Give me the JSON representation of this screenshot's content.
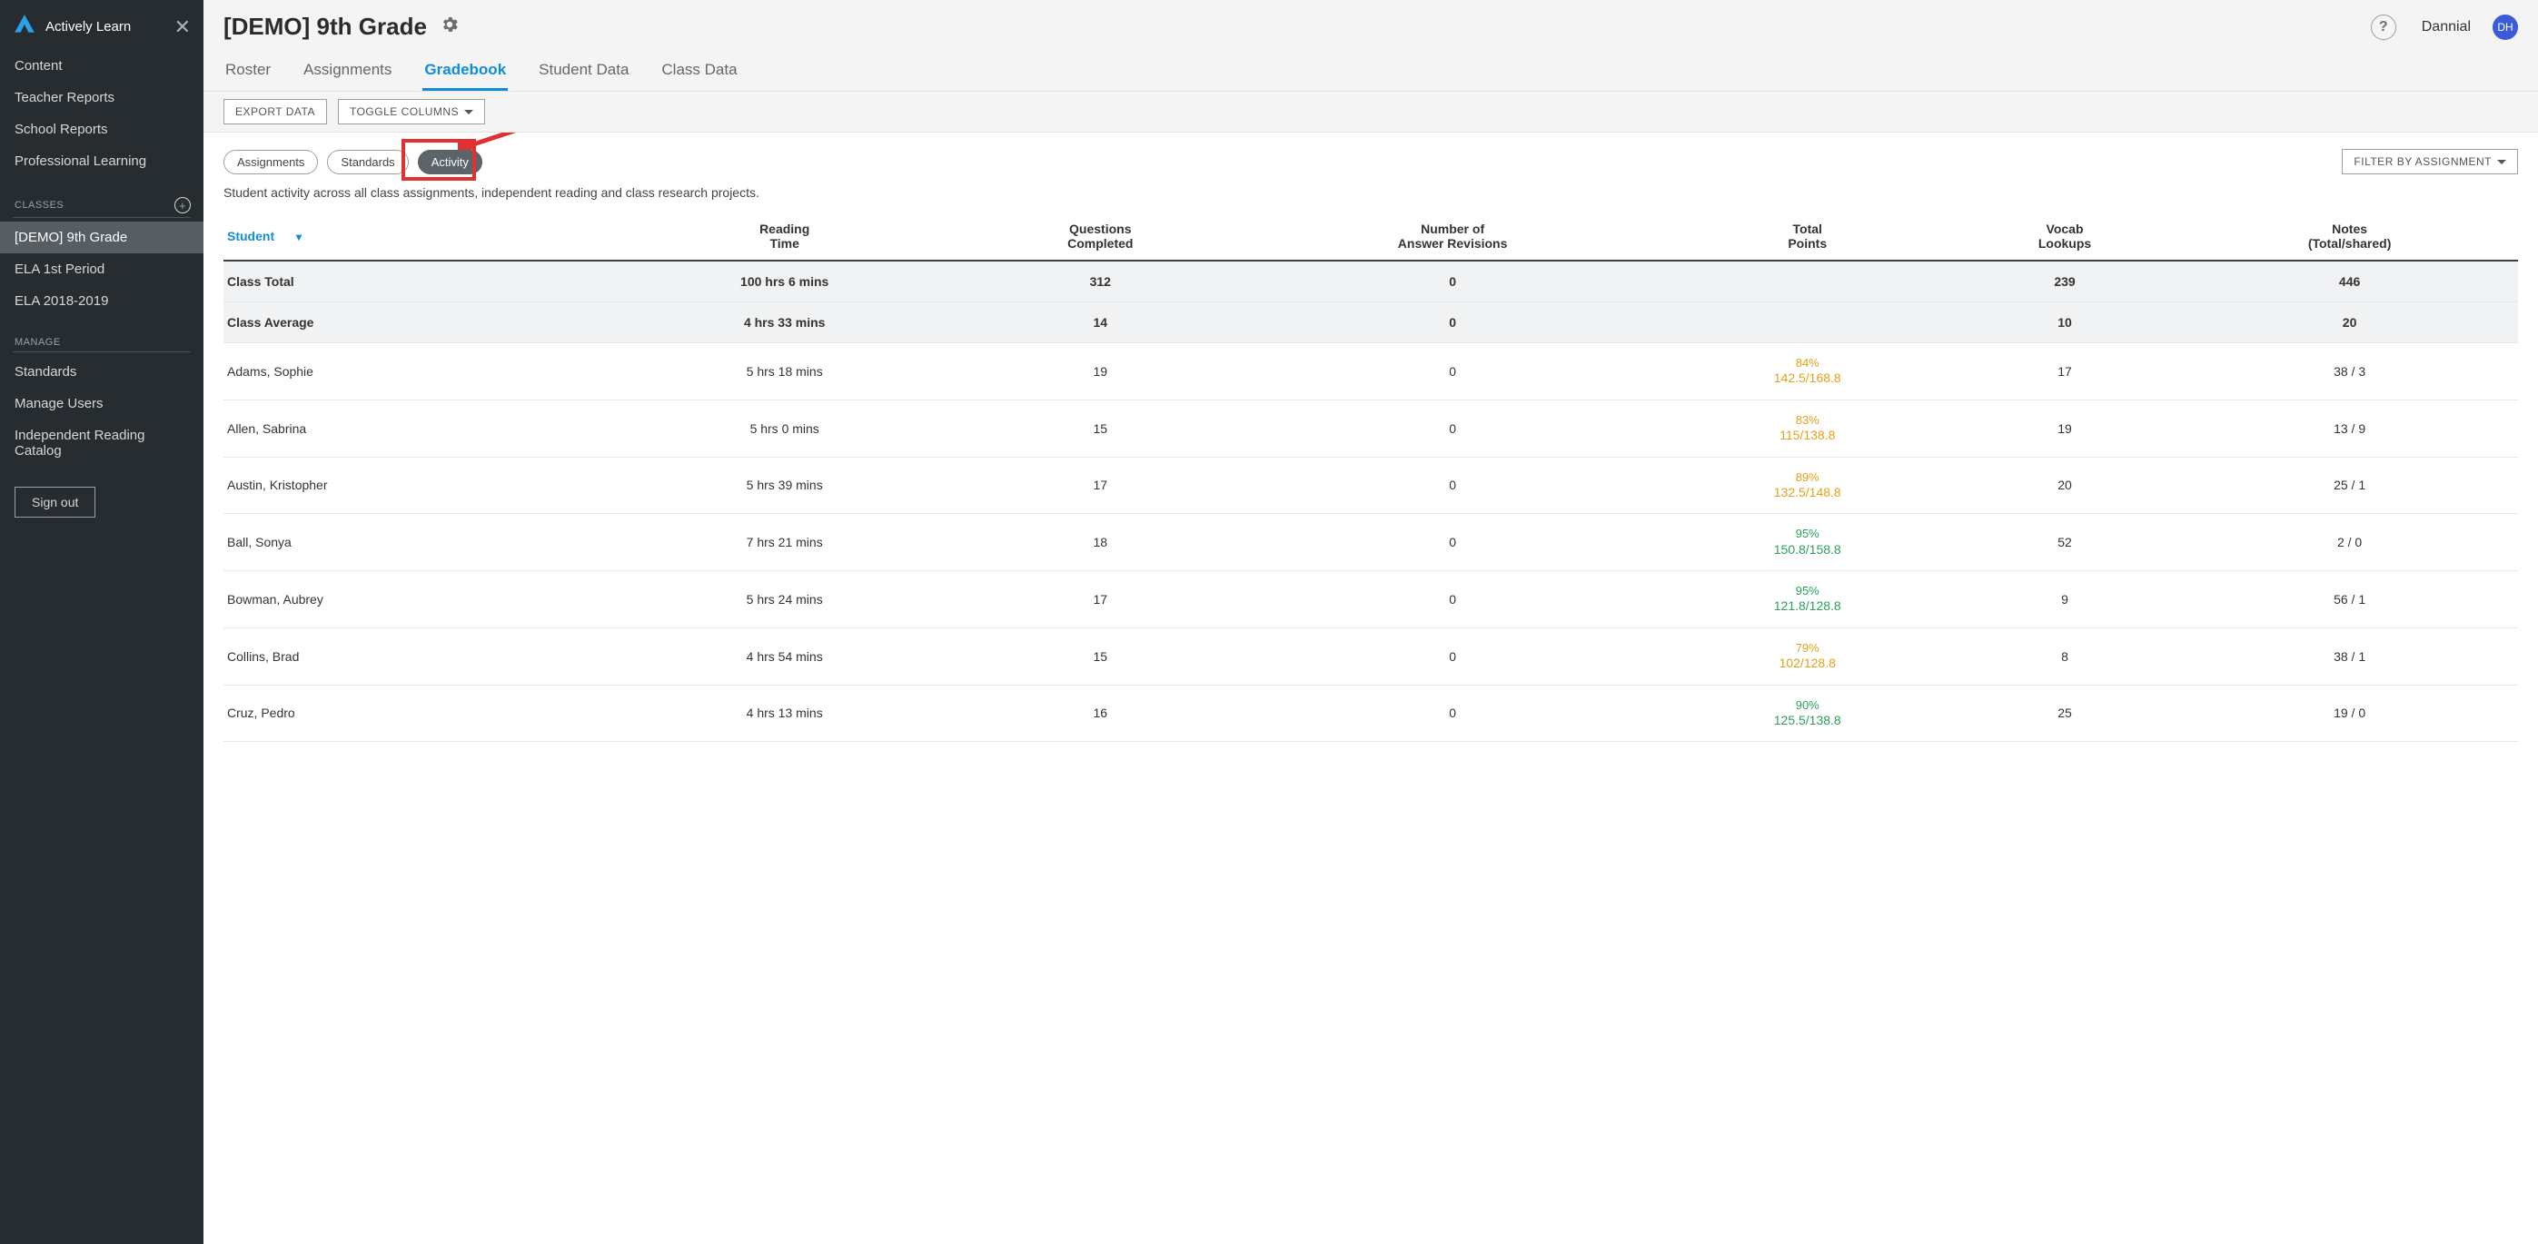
{
  "brand": "Actively Learn",
  "sidebar": {
    "main_links": [
      {
        "label": "Content"
      },
      {
        "label": "Teacher Reports"
      },
      {
        "label": "School Reports"
      },
      {
        "label": "Professional Learning"
      }
    ],
    "classes_heading": "CLASSES",
    "classes": [
      {
        "label": "[DEMO] 9th Grade",
        "active": true
      },
      {
        "label": "ELA 1st Period",
        "active": false
      },
      {
        "label": "ELA 2018-2019",
        "active": false
      }
    ],
    "manage_heading": "MANAGE",
    "manage": [
      {
        "label": "Standards"
      },
      {
        "label": "Manage Users"
      },
      {
        "label": "Independent Reading Catalog"
      }
    ],
    "signout": "Sign out"
  },
  "header": {
    "title": "[DEMO] 9th Grade",
    "username": "Dannial",
    "avatar_initials": "DH"
  },
  "tabs": [
    {
      "label": "Roster",
      "active": false
    },
    {
      "label": "Assignments",
      "active": false
    },
    {
      "label": "Gradebook",
      "active": true
    },
    {
      "label": "Student Data",
      "active": false
    },
    {
      "label": "Class Data",
      "active": false
    }
  ],
  "toolbar": {
    "export": "EXPORT DATA",
    "toggle_cols": "TOGGLE COLUMNS"
  },
  "pills": [
    {
      "label": "Assignments",
      "active": false
    },
    {
      "label": "Standards",
      "active": false
    },
    {
      "label": "Activity",
      "active": true
    }
  ],
  "filter_label": "FILTER BY ASSIGNMENT",
  "description": "Student activity across all class assignments, independent reading and class research projects.",
  "columns": {
    "student": "Student",
    "reading_time_l1": "Reading",
    "reading_time_l2": "Time",
    "questions_l1": "Questions",
    "questions_l2": "Completed",
    "revisions_l1": "Number of",
    "revisions_l2": "Answer Revisions",
    "points_l1": "Total",
    "points_l2": "Points",
    "vocab_l1": "Vocab",
    "vocab_l2": "Lookups",
    "notes_l1": "Notes",
    "notes_l2": "(Total/shared)"
  },
  "totals": [
    {
      "label": "Class Total",
      "reading": "100 hrs 6 mins",
      "questions": "312",
      "revisions": "0",
      "points_pct": "",
      "points_frac": "",
      "vocab": "239",
      "notes": "446"
    },
    {
      "label": "Class Average",
      "reading": "4 hrs 33 mins",
      "questions": "14",
      "revisions": "0",
      "points_pct": "",
      "points_frac": "",
      "vocab": "10",
      "notes": "20"
    }
  ],
  "rows": [
    {
      "name": "Adams, Sophie",
      "reading": "5 hrs 18 mins",
      "questions": "19",
      "revisions": "0",
      "pct": "84%",
      "frac": "142.5/168.8",
      "score_class": "score-orange",
      "vocab": "17",
      "notes": "38 / 3"
    },
    {
      "name": "Allen, Sabrina",
      "reading": "5 hrs 0 mins",
      "questions": "15",
      "revisions": "0",
      "pct": "83%",
      "frac": "115/138.8",
      "score_class": "score-orange",
      "vocab": "19",
      "notes": "13 / 9"
    },
    {
      "name": "Austin, Kristopher",
      "reading": "5 hrs 39 mins",
      "questions": "17",
      "revisions": "0",
      "pct": "89%",
      "frac": "132.5/148.8",
      "score_class": "score-orange",
      "vocab": "20",
      "notes": "25 / 1"
    },
    {
      "name": "Ball, Sonya",
      "reading": "7 hrs 21 mins",
      "questions": "18",
      "revisions": "0",
      "pct": "95%",
      "frac": "150.8/158.8",
      "score_class": "score-green",
      "vocab": "52",
      "notes": "2 / 0"
    },
    {
      "name": "Bowman, Aubrey",
      "reading": "5 hrs 24 mins",
      "questions": "17",
      "revisions": "0",
      "pct": "95%",
      "frac": "121.8/128.8",
      "score_class": "score-green",
      "vocab": "9",
      "notes": "56 / 1"
    },
    {
      "name": "Collins, Brad",
      "reading": "4 hrs 54 mins",
      "questions": "15",
      "revisions": "0",
      "pct": "79%",
      "frac": "102/128.8",
      "score_class": "score-orange",
      "vocab": "8",
      "notes": "38 / 1"
    },
    {
      "name": "Cruz, Pedro",
      "reading": "4 hrs 13 mins",
      "questions": "16",
      "revisions": "0",
      "pct": "90%",
      "frac": "125.5/138.8",
      "score_class": "score-green",
      "vocab": "25",
      "notes": "19 / 0"
    }
  ]
}
